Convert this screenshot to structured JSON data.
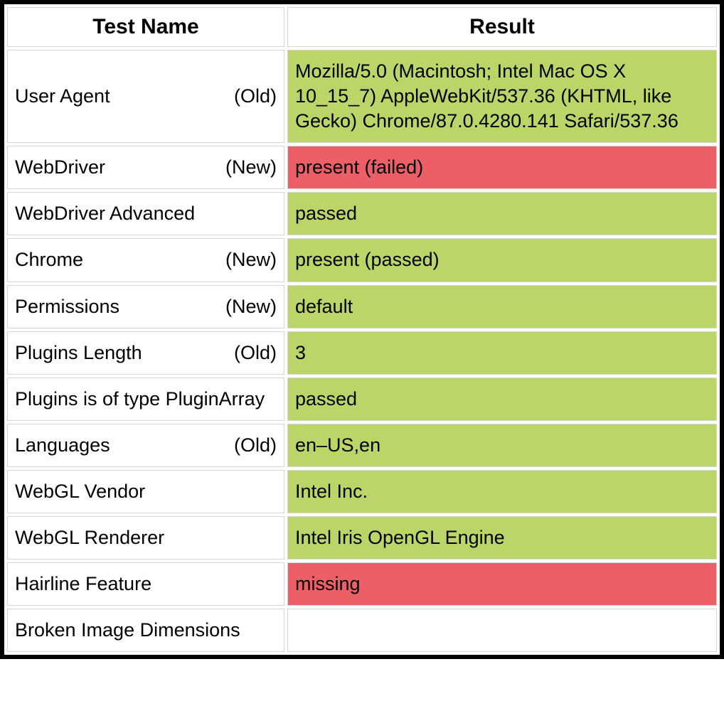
{
  "headers": {
    "test_name": "Test Name",
    "result": "Result"
  },
  "colors": {
    "pass": "#bbd569",
    "fail": "#ec5f67",
    "none": "#ffffff",
    "border": "#000000"
  },
  "rows": [
    {
      "name": "User Agent",
      "tag": "(Old)",
      "result": "Mozilla/5.0 (Macintosh; Intel Mac OS X 10_15_7) AppleWebKit/537.36 (KHTML, like Gecko) Chrome/87.0.4280.141 Safari/537.36",
      "status": "pass"
    },
    {
      "name": "WebDriver",
      "tag": "(New)",
      "result": "present (failed)",
      "status": "fail"
    },
    {
      "name": "WebDriver Advanced",
      "tag": "",
      "result": "passed",
      "status": "pass"
    },
    {
      "name": "Chrome",
      "tag": "(New)",
      "result": "present (passed)",
      "status": "pass"
    },
    {
      "name": "Permissions",
      "tag": "(New)",
      "result": "default",
      "status": "pass"
    },
    {
      "name": "Plugins Length",
      "tag": "(Old)",
      "result": "3",
      "status": "pass"
    },
    {
      "name": "Plugins is of type PluginArray",
      "tag": "",
      "result": "passed",
      "status": "pass"
    },
    {
      "name": "Languages",
      "tag": "(Old)",
      "result": "en–US,en",
      "status": "pass"
    },
    {
      "name": "WebGL Vendor",
      "tag": "",
      "result": "Intel Inc.",
      "status": "pass"
    },
    {
      "name": "WebGL Renderer",
      "tag": "",
      "result": "Intel Iris OpenGL Engine",
      "status": "pass"
    },
    {
      "name": "Hairline Feature",
      "tag": "",
      "result": "missing",
      "status": "fail"
    },
    {
      "name": "Broken Image Dimensions",
      "tag": "",
      "result": "",
      "status": "none"
    }
  ]
}
